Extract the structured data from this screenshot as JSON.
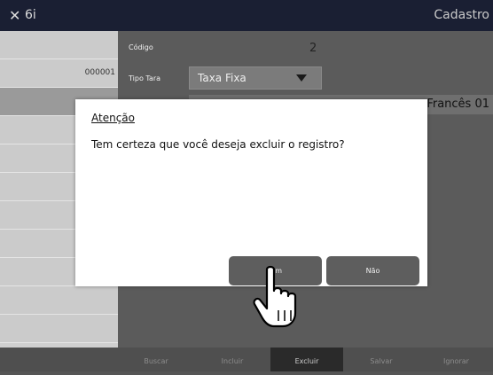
{
  "window": {
    "close_glyph": "✕",
    "app_label": "6i",
    "title": "Cadastro"
  },
  "left_list": {
    "rows": [
      {
        "value": ""
      },
      {
        "value": "000001"
      },
      {
        "value": ""
      },
      {
        "value": ""
      },
      {
        "value": ""
      },
      {
        "value": ""
      },
      {
        "value": ""
      },
      {
        "value": ""
      },
      {
        "value": ""
      },
      {
        "value": ""
      },
      {
        "value": ""
      }
    ]
  },
  "form": {
    "codigo_label": "Código",
    "codigo_value": "2",
    "tipo_tara_label": "Tipo Tara",
    "tipo_tara_value": "Taxa Fixa",
    "third_field_value": "Francês 01"
  },
  "toolbar": {
    "buscar": "Buscar",
    "incluir": "Incluir",
    "excluir": "Excluir",
    "salvar": "Salvar",
    "ignorar": "Ignorar"
  },
  "dialog": {
    "title": "Atenção",
    "message": "Tem certeza que você deseja excluir o registro?",
    "yes_label": "Sim",
    "no_label": "Não"
  },
  "cursor": {
    "icon": "hand-pointer"
  }
}
